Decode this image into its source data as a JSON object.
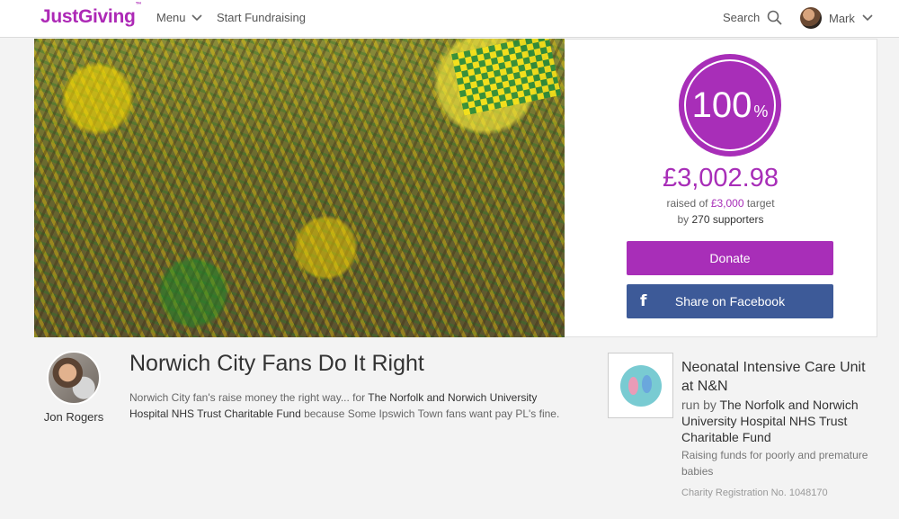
{
  "header": {
    "logo_text": "JustGiving",
    "logo_tm": "™",
    "menu_label": "Menu",
    "start_fundraising_label": "Start Fundraising",
    "search_label": "Search",
    "user_name": "Mark"
  },
  "stats": {
    "percent": "100",
    "percent_sign": "%",
    "percent_value": 100,
    "raised_amount": "£3,002.98",
    "raised_prefix": "raised of ",
    "target": "£3,000",
    "target_suffix": " target",
    "by_prefix": "by ",
    "supporters": "270 supporters",
    "donate_label": "Donate",
    "share_label": "Share on Facebook",
    "fb_icon": "f"
  },
  "fundraiser": {
    "owner_name": "Jon Rogers",
    "title": "Norwich City Fans Do It Right",
    "story_intro": "Norwich City fan's raise money the right way... for ",
    "story_charity": "The Norfolk and Norwich University Hospital NHS Trust Charitable Fund",
    "story_outro": " because Some Ipswich Town fans want pay PL's fine."
  },
  "charity": {
    "name": "Neonatal Intensive Care Unit at N&N",
    "run_by_prefix": "run by ",
    "run_by_name": "The Norfolk and Norwich University Hospital NHS Trust Charitable Fund",
    "description": "Raising funds for poorly and premature babies",
    "registration": "Charity Registration No. 1048170"
  },
  "colors": {
    "brand_purple": "#a82eb8",
    "facebook_blue": "#3d5a98"
  }
}
